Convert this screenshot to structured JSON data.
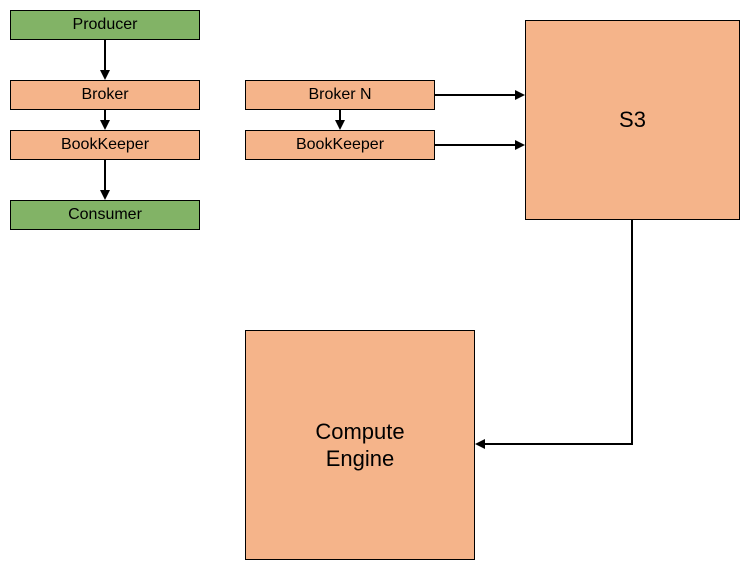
{
  "boxes": {
    "producer": "Producer",
    "broker": "Broker",
    "brokerN": "Broker N",
    "bookkeeper1": "BookKeeper",
    "bookkeeper2": "BookKeeper",
    "consumer": "Consumer",
    "s3": "S3",
    "compute": "Compute\nEngine"
  }
}
